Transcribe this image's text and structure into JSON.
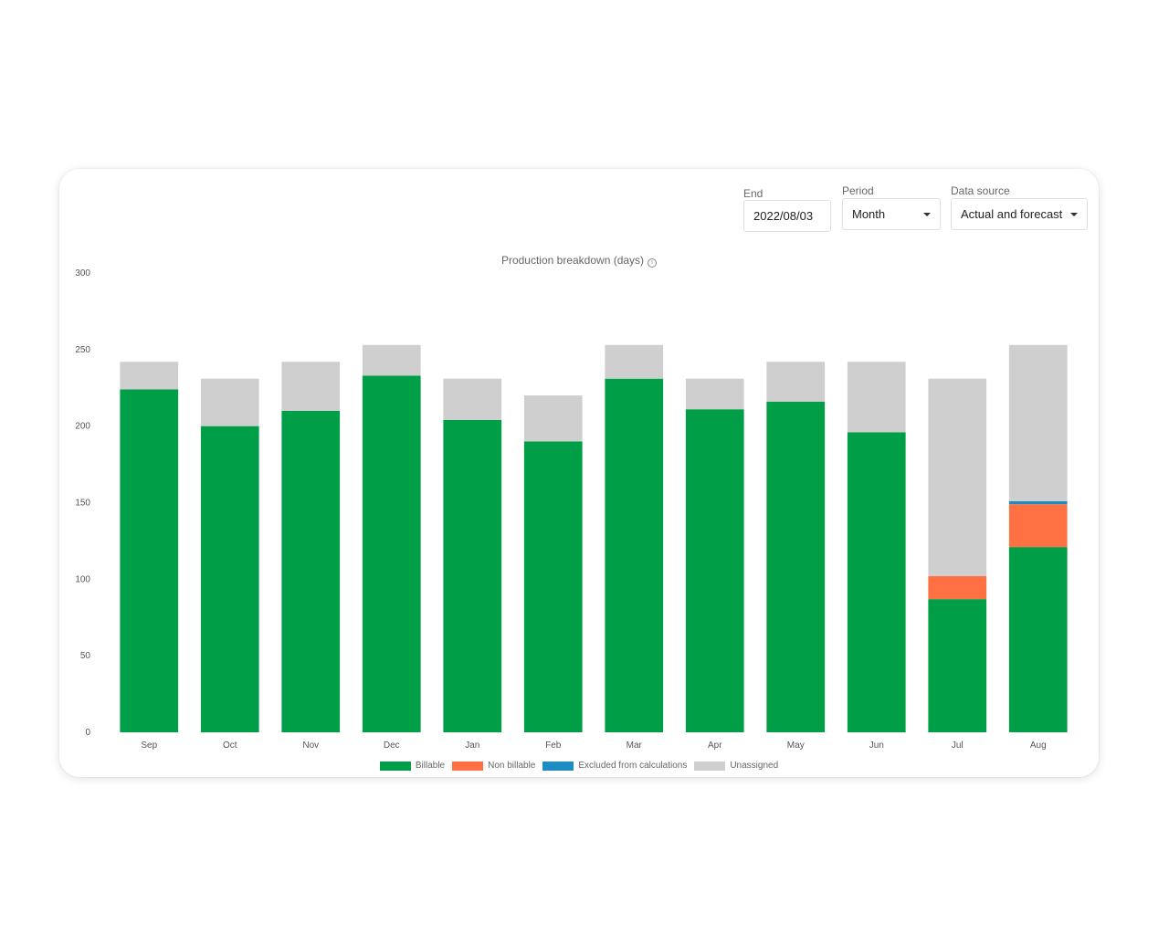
{
  "controls": {
    "end": {
      "label": "End",
      "value": "2022/08/03"
    },
    "period": {
      "label": "Period",
      "value": "Month"
    },
    "source": {
      "label": "Data source",
      "value": "Actual and forecast"
    }
  },
  "colors": {
    "billable": "#009e47",
    "non_billable": "#ff7043",
    "excluded": "#1e8bc3",
    "unassigned": "#cfcfcf"
  },
  "chart_data": {
    "type": "bar",
    "stacked": true,
    "title": "Production breakdown (days)",
    "categories": [
      "Sep",
      "Oct",
      "Nov",
      "Dec",
      "Jan",
      "Feb",
      "Mar",
      "Apr",
      "May",
      "Jun",
      "Jul",
      "Aug"
    ],
    "series": [
      {
        "name": "Billable",
        "values": [
          224,
          200,
          210,
          233,
          204,
          190,
          231,
          211,
          216,
          196,
          87,
          121
        ]
      },
      {
        "name": "Non billable",
        "values": [
          0,
          0,
          0,
          0,
          0,
          0,
          0,
          0,
          0,
          0,
          15,
          28
        ]
      },
      {
        "name": "Excluded from calculations",
        "values": [
          0,
          0,
          0,
          0,
          0,
          0,
          0,
          0,
          0,
          0,
          0,
          2
        ]
      },
      {
        "name": "Unassigned",
        "values": [
          18,
          31,
          32,
          20,
          27,
          30,
          22,
          20,
          26,
          46,
          129,
          102
        ]
      }
    ],
    "yticks": [
      0,
      50,
      100,
      150,
      200,
      250,
      300
    ],
    "ylim": [
      0,
      300
    ],
    "legend_position": "bottom",
    "grid": false
  }
}
